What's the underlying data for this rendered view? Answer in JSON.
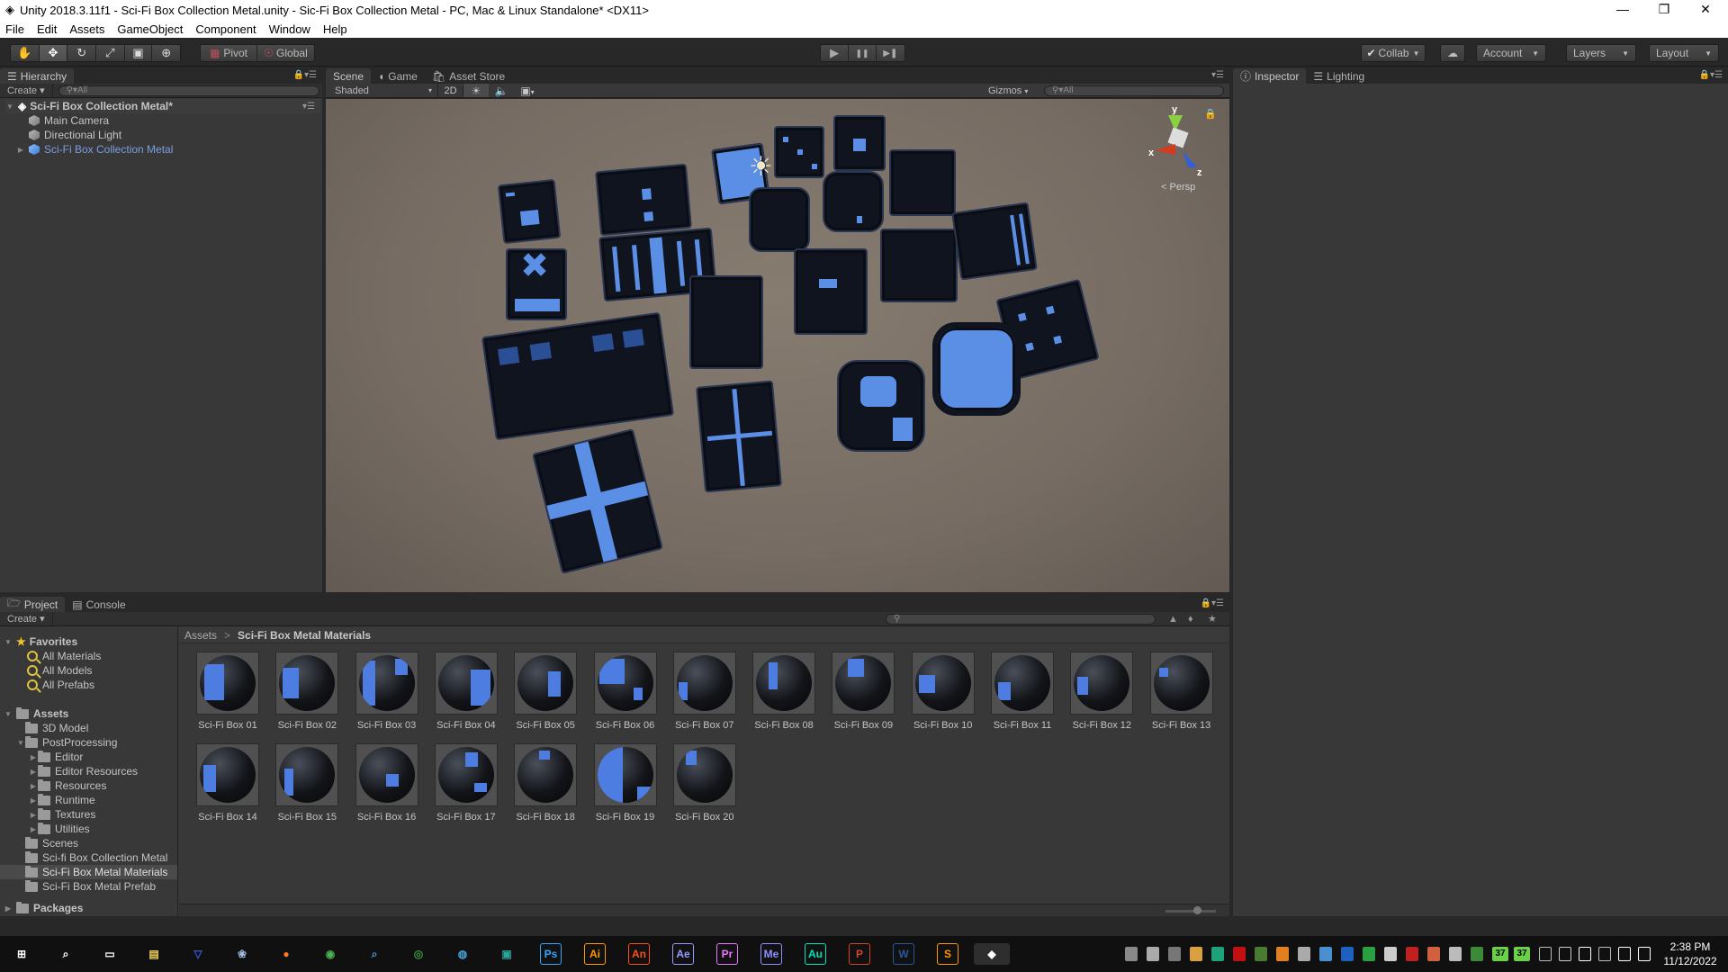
{
  "window": {
    "title": "Unity 2018.3.11f1 - Sci-Fi Box Collection Metal.unity - Sic-Fi Box Collection Metal - PC, Mac & Linux Standalone* <DX11>",
    "minimize": "—",
    "restore": "❐",
    "close": "✕"
  },
  "menu": [
    "File",
    "Edit",
    "Assets",
    "GameObject",
    "Component",
    "Window",
    "Help"
  ],
  "toolbar": {
    "tools": [
      {
        "icon": "hand-icon",
        "glyph": "✋"
      },
      {
        "icon": "move-icon",
        "glyph": "✥"
      },
      {
        "icon": "rotate-icon",
        "glyph": "↻"
      },
      {
        "icon": "scale-icon",
        "glyph": "⤢"
      },
      {
        "icon": "rect-icon",
        "glyph": "▣"
      },
      {
        "icon": "transform-icon",
        "glyph": "⊕"
      }
    ],
    "active_tool": 1,
    "pivot": "Pivot",
    "global": "Global",
    "play": "▶",
    "pause": "❚❚",
    "step": "▶❚",
    "collab": "Collab",
    "account": "Account",
    "layers": "Layers",
    "layout": "Layout"
  },
  "hierarchy": {
    "tab": "Hierarchy",
    "create": "Create",
    "search_placeholder": "All",
    "scene": "Sci-Fi Box Collection Metal*",
    "items": [
      {
        "label": "Main Camera",
        "selected": false
      },
      {
        "label": "Directional Light",
        "selected": false
      },
      {
        "label": "Sci-Fi Box Collection Metal",
        "prefab": true
      }
    ]
  },
  "sceneview": {
    "tabs": [
      "Scene",
      "Game",
      "Asset Store"
    ],
    "active_tab": "Scene",
    "shading": "Shaded",
    "mode2d": "2D",
    "gizmos": "Gizmos",
    "search_placeholder": "All",
    "gizmo_labels": {
      "x": "x",
      "y": "y",
      "z": "z"
    },
    "projection": "Persp"
  },
  "inspector": {
    "tabs": [
      "Inspector",
      "Lighting"
    ],
    "active_tab": "Inspector"
  },
  "project": {
    "tabs": [
      "Project",
      "Console"
    ],
    "active_tab": "Project",
    "create": "Create",
    "favorites_label": "Favorites",
    "favorites": [
      "All Materials",
      "All Models",
      "All Prefabs"
    ],
    "assets_label": "Assets",
    "tree": [
      {
        "label": "3D Model",
        "depth": 1,
        "expand": ""
      },
      {
        "label": "PostProcessing",
        "depth": 1,
        "expand": "open"
      },
      {
        "label": "Editor",
        "depth": 2,
        "expand": "closed"
      },
      {
        "label": "Editor Resources",
        "depth": 2,
        "expand": "closed"
      },
      {
        "label": "Resources",
        "depth": 2,
        "expand": "closed"
      },
      {
        "label": "Runtime",
        "depth": 2,
        "expand": "closed"
      },
      {
        "label": "Textures",
        "depth": 2,
        "expand": "closed"
      },
      {
        "label": "Utilities",
        "depth": 2,
        "expand": "closed"
      },
      {
        "label": "Scenes",
        "depth": 1,
        "expand": ""
      },
      {
        "label": "Sci-fi Box Collection Metal",
        "depth": 1,
        "expand": ""
      },
      {
        "label": "Sci-Fi Box Metal Materials",
        "depth": 1,
        "expand": "",
        "selected": true
      },
      {
        "label": "Sci-Fi Box Metal Prefab",
        "depth": 1,
        "expand": ""
      }
    ],
    "packages_label": "Packages",
    "breadcrumb": [
      "Assets",
      "Sci-Fi Box Metal Materials"
    ],
    "breadcrumb_sep": ">",
    "materials": [
      "Sci-Fi Box 01",
      "Sci-Fi Box 02",
      "Sci-Fi Box 03",
      "Sci-Fi Box 04",
      "Sci-Fi Box 05",
      "Sci-Fi Box 06",
      "Sci-Fi Box 07",
      "Sci-Fi Box 08",
      "Sci-Fi Box 09",
      "Sci-Fi Box 10",
      "Sci-Fi Box 11",
      "Sci-Fi Box 12",
      "Sci-Fi Box 13",
      "Sci-Fi Box 14",
      "Sci-Fi Box 15",
      "Sci-Fi Box 16",
      "Sci-Fi Box 17",
      "Sci-Fi Box 18",
      "Sci-Fi Box 19",
      "Sci-Fi Box 20"
    ]
  },
  "taskbar": {
    "apps": [
      {
        "name": "start",
        "glyph": "⊞",
        "color": "#ffffff"
      },
      {
        "name": "search",
        "glyph": "⌕",
        "color": "#ffffff"
      },
      {
        "name": "task-view",
        "glyph": "▭",
        "color": "#ffffff"
      },
      {
        "name": "file-explorer",
        "glyph": "▤",
        "color": "#f0d060"
      },
      {
        "name": "app-blue",
        "glyph": "▽",
        "color": "#3b5bd6"
      },
      {
        "name": "paint",
        "glyph": "❀",
        "color": "#9fc0e0"
      },
      {
        "name": "firefox",
        "glyph": "●",
        "color": "#ff7a1a"
      },
      {
        "name": "chrome",
        "glyph": "◉",
        "color": "#4caf50"
      },
      {
        "name": "search-app",
        "glyph": "⌕",
        "color": "#4a9ad4"
      },
      {
        "name": "globe-green",
        "glyph": "◎",
        "color": "#3c9a3c"
      },
      {
        "name": "globe",
        "glyph": "◍",
        "color": "#4aa0d8"
      },
      {
        "name": "app-teal",
        "glyph": "▣",
        "color": "#2fa39a"
      },
      {
        "name": "photoshop",
        "glyph": "Ps",
        "color": "#31a8ff"
      },
      {
        "name": "illustrator",
        "glyph": "Ai",
        "color": "#ff9a00"
      },
      {
        "name": "animate",
        "glyph": "An",
        "color": "#ff4f1a"
      },
      {
        "name": "after-effects",
        "glyph": "Ae",
        "color": "#9999ff"
      },
      {
        "name": "premiere",
        "glyph": "Pr",
        "color": "#ea77ff"
      },
      {
        "name": "media-encoder",
        "glyph": "Me",
        "color": "#8f8fff"
      },
      {
        "name": "audition",
        "glyph": "Au",
        "color": "#00e4bb"
      },
      {
        "name": "powerpoint",
        "glyph": "P",
        "color": "#d24726"
      },
      {
        "name": "word",
        "glyph": "W",
        "color": "#2b579a"
      },
      {
        "name": "sublime",
        "glyph": "S",
        "color": "#ff9800"
      },
      {
        "name": "unity",
        "glyph": "◆",
        "color": "#ffffff"
      }
    ],
    "tray_badges": [
      "37",
      "37"
    ],
    "time": "2:38 PM",
    "date": "11/12/2022"
  }
}
